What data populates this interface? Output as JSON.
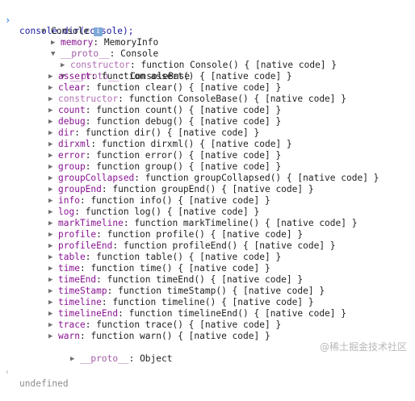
{
  "command": "console.dir(console);",
  "root": {
    "label": "Console",
    "info_icon": "info-icon"
  },
  "memory": {
    "key": "memory",
    "value": "MemoryInfo"
  },
  "proto1": {
    "key": "__proto__",
    "value": "Console"
  },
  "constructor1": {
    "key": "constructor",
    "value": "function Console() { [native code] }"
  },
  "proto2": {
    "key": "__proto__",
    "value": "ConsoleBase"
  },
  "methods": [
    {
      "key": "assert",
      "value": "function assert() { [native code] }"
    },
    {
      "key": "clear",
      "value": "function clear() { [native code] }"
    },
    {
      "key": "constructor",
      "value": "function ConsoleBase() { [native code] }"
    },
    {
      "key": "count",
      "value": "function count() { [native code] }"
    },
    {
      "key": "debug",
      "value": "function debug() { [native code] }"
    },
    {
      "key": "dir",
      "value": "function dir() { [native code] }"
    },
    {
      "key": "dirxml",
      "value": "function dirxml() { [native code] }"
    },
    {
      "key": "error",
      "value": "function error() { [native code] }"
    },
    {
      "key": "group",
      "value": "function group() { [native code] }"
    },
    {
      "key": "groupCollapsed",
      "value": "function groupCollapsed() { [native code] }"
    },
    {
      "key": "groupEnd",
      "value": "function groupEnd() { [native code] }"
    },
    {
      "key": "info",
      "value": "function info() { [native code] }"
    },
    {
      "key": "log",
      "value": "function log() { [native code] }"
    },
    {
      "key": "markTimeline",
      "value": "function markTimeline() { [native code] }"
    },
    {
      "key": "profile",
      "value": "function profile() { [native code] }"
    },
    {
      "key": "profileEnd",
      "value": "function profileEnd() { [native code] }"
    },
    {
      "key": "table",
      "value": "function table() { [native code] }"
    },
    {
      "key": "time",
      "value": "function time() { [native code] }"
    },
    {
      "key": "timeEnd",
      "value": "function timeEnd() { [native code] }"
    },
    {
      "key": "timeStamp",
      "value": "function timeStamp() { [native code] }"
    },
    {
      "key": "timeline",
      "value": "function timeline() { [native code] }"
    },
    {
      "key": "timelineEnd",
      "value": "function timelineEnd() { [native code] }"
    },
    {
      "key": "trace",
      "value": "function trace() { [native code] }"
    },
    {
      "key": "warn",
      "value": "function warn() { [native code] }"
    }
  ],
  "proto3": {
    "key": "__proto__",
    "value": "Object"
  },
  "result": "undefined",
  "watermark": "@稀土掘金技术社区"
}
